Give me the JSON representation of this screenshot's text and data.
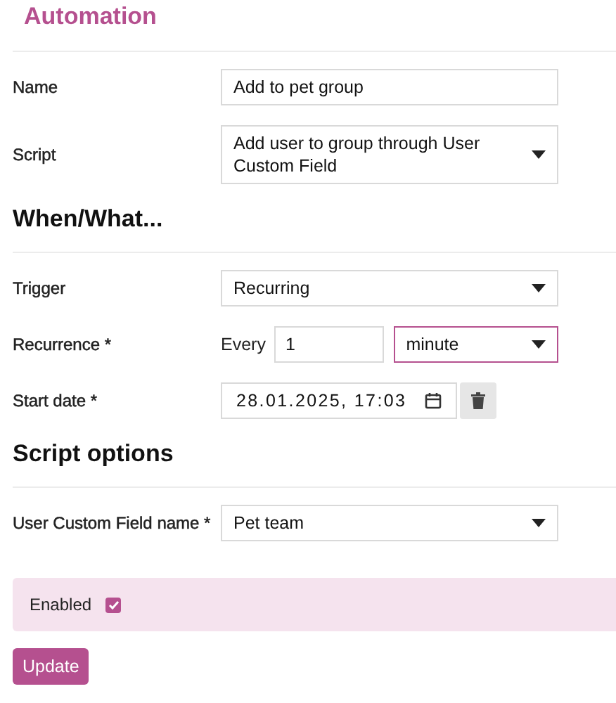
{
  "title": "Automation",
  "sections": [
    {
      "fields": [
        {
          "kind": "text",
          "label": "Name",
          "value": "Add to pet group"
        },
        {
          "kind": "select",
          "label": "Script",
          "value": "Add user to group through User Custom Field"
        }
      ]
    },
    {
      "heading": "When/What...",
      "fields": [
        {
          "kind": "select",
          "label": "Trigger",
          "value": "Recurring"
        },
        {
          "kind": "recurrence",
          "label": "Recurrence *",
          "prefix": "Every",
          "value": "1",
          "unit": "minute",
          "unit_focused": true
        },
        {
          "kind": "datetime",
          "label": "Start date *",
          "value": "28.01.2025, 17:03"
        }
      ]
    },
    {
      "heading": "Script options",
      "fields": [
        {
          "kind": "select",
          "label": "User Custom Field name *",
          "value": "Pet team"
        }
      ]
    }
  ],
  "enabled": {
    "label": "Enabled",
    "checked": true
  },
  "submit": "Update"
}
